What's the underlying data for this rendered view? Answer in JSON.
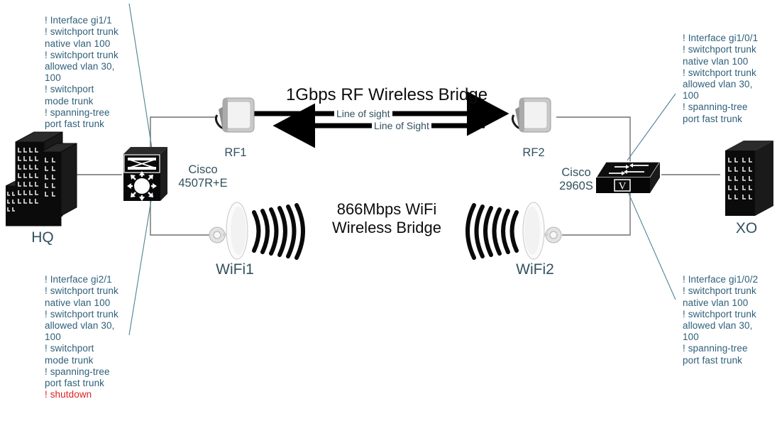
{
  "diagram": {
    "title": "Wireless bridge network topology",
    "colors": {
      "config_text": "#2e5f7a",
      "shutdown_text": "#e02020",
      "caption_text": "#31525f",
      "headline_text": "#0d0d0d",
      "wire": "#6e6e6e",
      "leader": "#4f8296",
      "device_black": "#000000",
      "antenna_gray": "#d9d9d9"
    },
    "annotations": [
      {
        "id": "cfg-top-left",
        "position": "top-left",
        "target": "cisco-4507re",
        "lines": [
          "! Interface gi1/1",
          "! switchport trunk",
          "native vlan 100",
          "! switchport trunk",
          "allowed vlan 30,",
          "100",
          "! switchport",
          "mode trunk",
          "! spanning-tree",
          "port fast trunk"
        ],
        "shutdown": null
      },
      {
        "id": "cfg-bottom-left",
        "position": "bottom-left",
        "target": "cisco-4507re",
        "lines": [
          "! Interface gi2/1",
          "! switchport trunk",
          "native vlan 100",
          "! switchport trunk",
          "allowed vlan 30,",
          "100",
          "! switchport",
          "mode trunk",
          "! spanning-tree",
          "port fast trunk"
        ],
        "shutdown": "! shutdown"
      },
      {
        "id": "cfg-top-right",
        "position": "top-right",
        "target": "cisco-2960s",
        "lines": [
          "! Interface gi1/0/1",
          "! switchport trunk",
          "native vlan 100",
          "! switchport trunk",
          "allowed vlan 30,",
          "100",
          "! spanning-tree",
          "port fast trunk"
        ],
        "shutdown": null
      },
      {
        "id": "cfg-bottom-right",
        "position": "bottom-right",
        "target": "cisco-2960s",
        "lines": [
          "! Interface gi1/0/2",
          "! switchport trunk",
          "native vlan 100",
          "! switchport trunk",
          "allowed vlan 30,",
          "100",
          "! spanning-tree",
          "port fast trunk"
        ],
        "shutdown": null
      }
    ],
    "nodes": {
      "hq": {
        "label": "HQ",
        "icon": "office-buildings-icon"
      },
      "xo": {
        "label": "XO",
        "icon": "office-building-icon"
      },
      "core_switch": {
        "label": "Cisco\n4507R+E",
        "icon": "multilayer-switch-icon"
      },
      "edge_switch": {
        "label": "Cisco\n2960S",
        "icon": "workgroup-switch-icon"
      },
      "rf1": {
        "label": "RF1",
        "icon": "panel-antenna-icon"
      },
      "rf2": {
        "label": "RF2",
        "icon": "panel-antenna-icon"
      },
      "wifi1": {
        "label": "WiFi1",
        "icon": "dish-antenna-icon"
      },
      "wifi2": {
        "label": "WiFi2",
        "icon": "dish-antenna-icon"
      }
    },
    "links": {
      "rf_bridge": {
        "headline": "1Gbps RF Wireless Bridge",
        "forward_label": "Line of sight",
        "reverse_label": "Line of Sight"
      },
      "wifi_bridge": {
        "headline": "866Mbps WiFi\nWireless Bridge"
      }
    }
  }
}
